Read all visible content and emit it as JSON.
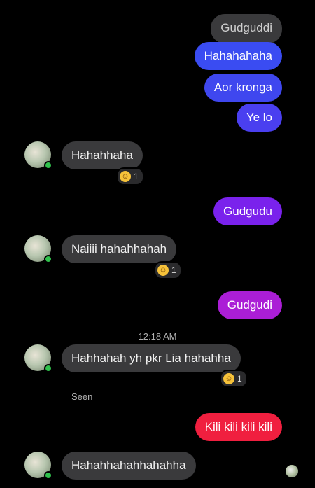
{
  "sent_messages": [
    {
      "text": "Gudguddi"
    },
    {
      "text": "Hahahahaha"
    },
    {
      "text": "Aor kronga"
    },
    {
      "text": "Ye lo"
    },
    {
      "text": "Gudgudu"
    },
    {
      "text": "Gudgudi"
    },
    {
      "text": "Kili kili kili kili"
    }
  ],
  "received_messages": [
    {
      "text": "Hahahhaha",
      "reaction_count": "1"
    },
    {
      "text": "Naiiii hahahhahah",
      "reaction_count": "1"
    },
    {
      "text": "Hahhahah yh pkr Lia hahahha",
      "reaction_count": "1"
    },
    {
      "text": "Hahahhahahhahahha"
    }
  ],
  "timestamp": "12:18 AM",
  "seen_label": "Seen",
  "reaction_icon": "laughing-emoji-icon",
  "colors": {
    "gradient_blue": "#3b4df0",
    "purple": "#8a1fe6",
    "magenta": "#b21dcf",
    "red": "#f0203f",
    "incoming": "#3a3a3c",
    "online": "#31c24d"
  }
}
